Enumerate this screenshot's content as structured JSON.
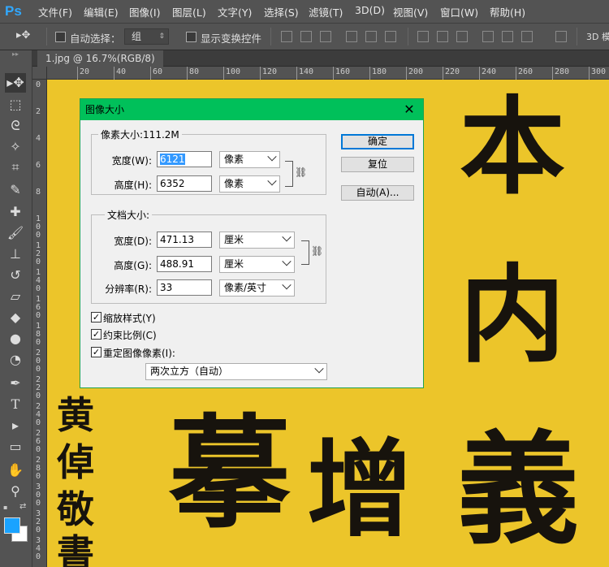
{
  "app": {
    "logo": "Ps"
  },
  "menubar": {
    "items": [
      "文件(F)",
      "编辑(E)",
      "图像(I)",
      "图层(L)",
      "文字(Y)",
      "选择(S)",
      "滤镜(T)",
      "3D(D)",
      "视图(V)",
      "窗口(W)",
      "帮助(H)"
    ]
  },
  "options": {
    "auto_select_label": "自动选择：",
    "auto_select_value": "组",
    "show_transform_label": "显示变换控件",
    "mode_3d_label": "3D 模"
  },
  "tab": {
    "label": "1.jpg @ 16.7%(RGB/8)"
  },
  "ruler": {
    "top": [
      "20",
      "40",
      "60",
      "80",
      "100",
      "120",
      "140",
      "160",
      "180",
      "200",
      "220",
      "240",
      "260",
      "280",
      "300"
    ],
    "left": [
      "0",
      "2",
      "4",
      "6",
      "8",
      "1\n0\n0",
      "1\n2\n0",
      "1\n4\n0",
      "1\n6\n0",
      "1\n8\n0",
      "2\n0\n0",
      "2\n2\n0",
      "2\n4\n0",
      "2\n6\n0",
      "2\n8\n0",
      "3\n0\n0",
      "3\n2\n0",
      "3\n4\n0"
    ]
  },
  "canvas": {
    "chars": [
      "本",
      "内",
      "摹",
      "增",
      "義",
      "黄",
      "倬",
      "敬",
      "書"
    ]
  },
  "dialog": {
    "title": "图像大小",
    "pixel_size_label": "像素大小:111.2M",
    "width_label": "宽度(W):",
    "width_value": "6121",
    "width_unit": "像素",
    "height_label": "高度(H):",
    "height_value": "6352",
    "height_unit": "像素",
    "doc_size_label": "文档大小:",
    "doc_width_label": "宽度(D):",
    "doc_width_value": "471.13",
    "doc_width_unit": "厘米",
    "doc_height_label": "高度(G):",
    "doc_height_value": "488.91",
    "doc_height_unit": "厘米",
    "resolution_label": "分辨率(R):",
    "resolution_value": "33",
    "resolution_unit": "像素/英寸",
    "scale_styles_label": "缩放样式(Y)",
    "constrain_label": "约束比例(C)",
    "resample_label": "重定图像像素(I):",
    "resample_method": "两次立方（自动）",
    "ok_label": "确定",
    "reset_label": "复位",
    "auto_label": "自动(A)..."
  },
  "colors": {
    "accent": "#00c05a",
    "foreground": "#1aa3ff",
    "background": "#ffffff",
    "canvas": "#ecc52a"
  }
}
